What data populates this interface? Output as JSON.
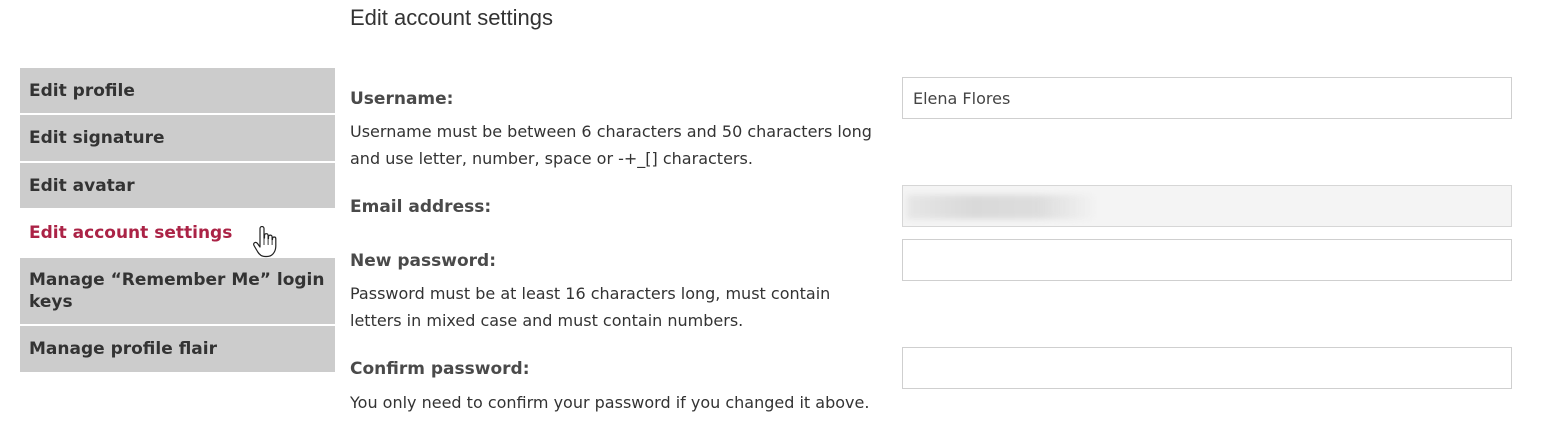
{
  "page": {
    "title": "Edit account settings"
  },
  "tabs": [
    {
      "label": "Edit profile",
      "active": false
    },
    {
      "label": "Edit signature",
      "active": false
    },
    {
      "label": "Edit avatar",
      "active": false
    },
    {
      "label": "Edit account settings",
      "active": true
    },
    {
      "label": "Manage “Remember Me” login keys",
      "active": false
    },
    {
      "label": "Manage profile flair",
      "active": false
    }
  ],
  "form": {
    "username": {
      "label": "Username:",
      "help": "Username must be between 6 characters and 50 characters long and use letter, number, space or -+_[] characters.",
      "value": "Elena Flores"
    },
    "email": {
      "label": "Email address:",
      "value_obscured": true
    },
    "new_password": {
      "label": "New password:",
      "help": "Password must be at least 16 characters long, must contain letters in mixed case and must contain numbers.",
      "value": ""
    },
    "confirm_password": {
      "label": "Confirm password:",
      "help": "You only need to confirm your password if you changed it above.",
      "value": ""
    }
  },
  "colors": {
    "active_tab_text": "#ab2346",
    "tab_background": "#cccccc",
    "text": "#333333"
  },
  "icons": {
    "cursor": "hand-pointer-icon"
  }
}
